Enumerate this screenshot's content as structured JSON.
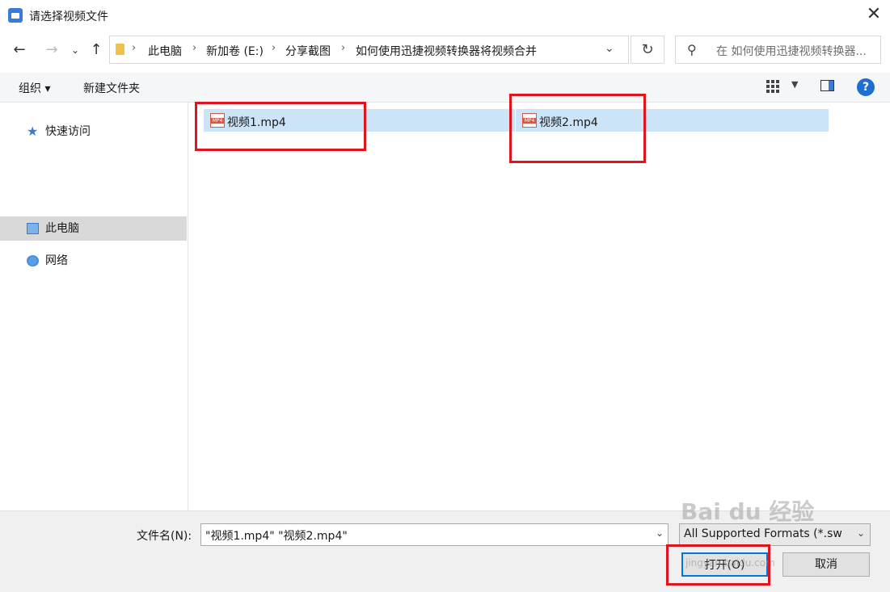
{
  "window": {
    "title": "请选择视频文件"
  },
  "address": {
    "breadcrumbs": [
      "此电脑",
      "新加卷 (E:)",
      "分享截图",
      "如何使用迅捷视频转换器将视频合并"
    ],
    "search_placeholder": "在 如何使用迅捷视频转换器..."
  },
  "toolbar": {
    "organize": "组织 ▾",
    "new_folder": "新建文件夹"
  },
  "sidebar": {
    "items": [
      {
        "label": "快速访问",
        "icon": "star-icon"
      },
      {
        "label": "此电脑",
        "icon": "computer-icon",
        "selected": true
      },
      {
        "label": "网络",
        "icon": "network-icon"
      }
    ]
  },
  "files": [
    {
      "name": "视频1.mp4",
      "icon": "mp4-file-icon",
      "selected": true
    },
    {
      "name": "视频2.mp4",
      "icon": "mp4-file-icon",
      "selected": true
    }
  ],
  "footer": {
    "filename_label": "文件名(N):",
    "filename_value": "\"视频1.mp4\" \"视频2.mp4\"",
    "filetype_value": "All Supported Formats (*.sw",
    "open_button": "打开(O)",
    "cancel_button": "取消"
  },
  "watermark": {
    "brand": "Bai du 经验",
    "url": "jingyan.baidu.com"
  },
  "colors": {
    "highlight": "#e0141c",
    "selection": "#cce4f7",
    "accent": "#0078d7"
  }
}
